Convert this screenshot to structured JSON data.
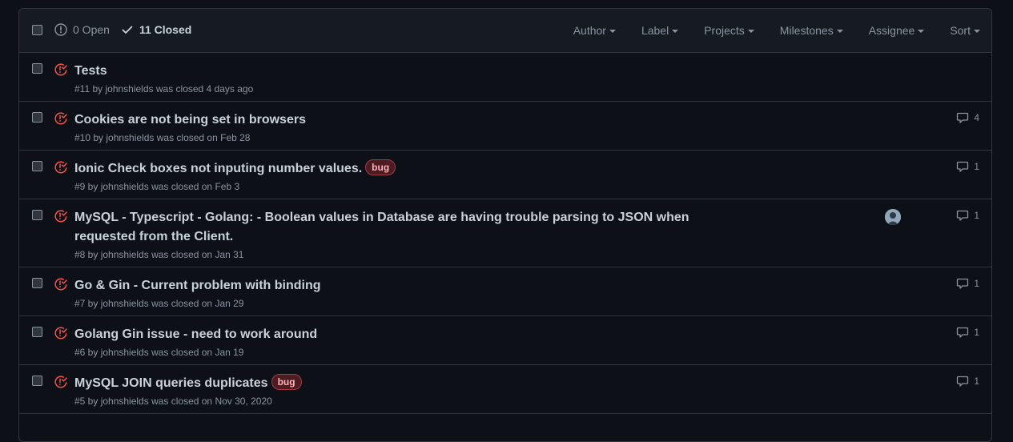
{
  "header": {
    "open_label": "0 Open",
    "closed_label": "11 Closed",
    "filters": [
      {
        "label": "Author"
      },
      {
        "label": "Label"
      },
      {
        "label": "Projects"
      },
      {
        "label": "Milestones"
      },
      {
        "label": "Assignee"
      },
      {
        "label": "Sort"
      }
    ]
  },
  "issues": [
    {
      "title": "Tests",
      "meta": "#11 by johnshields was closed 4 days ago",
      "comments": "",
      "label": "",
      "assignee": false
    },
    {
      "title": "Cookies are not being set in browsers",
      "meta": "#10 by johnshields was closed on Feb 28",
      "comments": "4",
      "label": "",
      "assignee": false
    },
    {
      "title": "Ionic Check boxes not inputing number values.",
      "meta": "#9 by johnshields was closed on Feb 3",
      "comments": "1",
      "label": "bug",
      "assignee": false
    },
    {
      "title": "MySQL - Typescript - Golang: - Boolean values in Database are having trouble parsing to JSON when requested from the Client.",
      "meta": "#8 by johnshields was closed on Jan 31",
      "comments": "1",
      "label": "",
      "assignee": true
    },
    {
      "title": "Go & Gin - Current problem with binding",
      "meta": "#7 by johnshields was closed on Jan 29",
      "comments": "1",
      "label": "",
      "assignee": false
    },
    {
      "title": "Golang Gin issue - need to work around",
      "meta": "#6 by johnshields was closed on Jan 19",
      "comments": "1",
      "label": "",
      "assignee": false
    },
    {
      "title": "MySQL JOIN queries duplicates",
      "meta": "#5 by johnshields was closed on Nov 30, 2020",
      "comments": "1",
      "label": "bug",
      "assignee": false
    }
  ],
  "colors": {
    "closed_icon": "#f85149",
    "background": "#0d1117",
    "header_bg": "#161b22",
    "border": "#30363d"
  },
  "icons": {
    "open_state": "issue-opened-icon",
    "closed_state": "check-icon",
    "issue_status": "issue-closed-icon",
    "comments": "comment-icon"
  }
}
